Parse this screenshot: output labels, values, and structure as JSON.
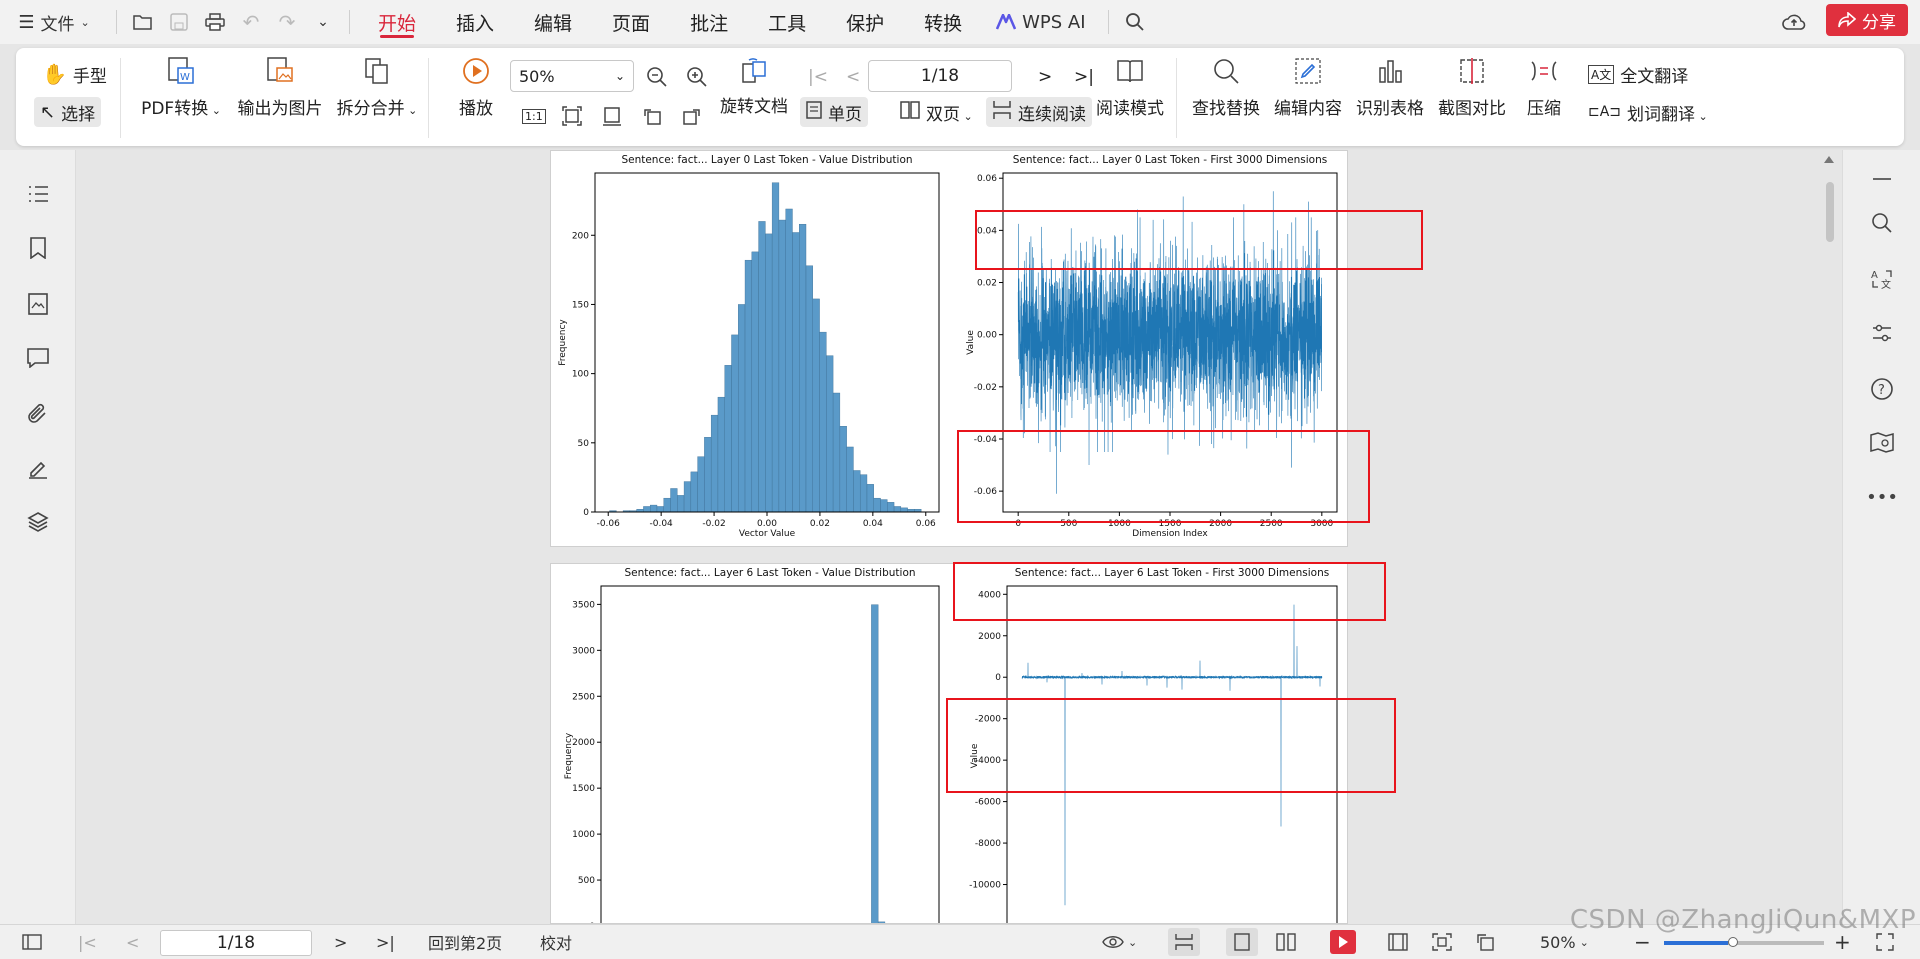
{
  "menubar": {
    "file_label": "文件",
    "tabs": [
      "开始",
      "插入",
      "编辑",
      "页面",
      "批注",
      "工具",
      "保护",
      "转换"
    ],
    "active_tab": "开始",
    "wps_ai_label": "WPS AI",
    "share_label": "分享",
    "accent_color": "#d9263b"
  },
  "ribbon": {
    "hand_label": "手型",
    "select_label": "选择",
    "pdf_convert_label": "PDF转换",
    "export_image_label": "输出为图片",
    "split_merge_label": "拆分合并",
    "play_label": "播放",
    "zoom_value": "50%",
    "page_value": "1/18",
    "rotate_label": "旋转文档",
    "single_page_label": "单页",
    "double_page_label": "双页",
    "continuous_label": "连续阅读",
    "reading_mode_label": "阅读模式",
    "find_replace_label": "查找替换",
    "edit_content_label": "编辑内容",
    "recognize_table_label": "识别表格",
    "screenshot_compare_label": "截图对比",
    "compress_label": "压缩",
    "full_translate_label": "全文翻译",
    "word_translate_label": "划词翻译"
  },
  "statusbar": {
    "page_value": "1/18",
    "back_label": "回到第2页",
    "proofread_label": "校对",
    "zoom_value": "50%"
  },
  "watermark": "CSDN @ZhangJiQun&MXP",
  "chart_data": [
    {
      "type": "bar",
      "title": "Sentence: fact... Layer 0 Last Token - Value Distribution",
      "xlabel": "Vector Value",
      "ylabel": "Frequency",
      "xlim": [
        -0.065,
        0.065
      ],
      "ylim": [
        0,
        245
      ],
      "xticks": [
        "-0.06",
        "-0.04",
        "-0.02",
        "0.00",
        "0.02",
        "0.04",
        "0.06"
      ],
      "xtick_values": [
        -0.06,
        -0.04,
        -0.02,
        0.0,
        0.02,
        0.04,
        0.06
      ],
      "yticks": [
        0,
        50,
        100,
        150,
        200
      ],
      "bin_start": -0.0595,
      "bin_width": 0.00256,
      "values": [
        1,
        0,
        1,
        1,
        2,
        4,
        5,
        4,
        10,
        17,
        12,
        22,
        29,
        40,
        54,
        70,
        83,
        106,
        128,
        150,
        182,
        188,
        210,
        201,
        238,
        211,
        219,
        202,
        208,
        178,
        154,
        130,
        113,
        86,
        62,
        47,
        30,
        27,
        20,
        10,
        9,
        7,
        4,
        3,
        2,
        2
      ],
      "bar_color": "#5a9ac9"
    },
    {
      "type": "line",
      "title": "Sentence: fact... Layer 0 Last Token - First 3000 Dimensions",
      "xlabel": "Dimension Index",
      "ylabel": "Value",
      "xlim": [
        -150,
        3150
      ],
      "ylim": [
        -0.068,
        0.062
      ],
      "xticks": [
        "0",
        "500",
        "1000",
        "1500",
        "2000",
        "2500",
        "3000"
      ],
      "xtick_values": [
        0,
        500,
        1000,
        1500,
        2000,
        2500,
        3000
      ],
      "yticks": [
        "-0.06",
        "-0.04",
        "-0.02",
        "0.00",
        "0.02",
        "0.04",
        "0.06"
      ],
      "ytick_values": [
        -0.06,
        -0.04,
        -0.02,
        0.0,
        0.02,
        0.04,
        0.06
      ],
      "n_points": 3000,
      "noise_sd": 0.015,
      "spikes": [
        [
          380,
          -0.061
        ],
        [
          700,
          -0.05
        ],
        [
          1180,
          0.048
        ],
        [
          1480,
          -0.046
        ],
        [
          1630,
          0.053
        ],
        [
          2230,
          0.05
        ],
        [
          2520,
          0.055
        ],
        [
          2700,
          -0.051
        ],
        [
          2870,
          0.051
        ]
      ],
      "line_color": "#1f77b4"
    },
    {
      "type": "bar",
      "title": "Sentence: fact... Layer 6 Last Token - Value Distribution",
      "xlabel": "",
      "ylabel": "Frequency",
      "xlim": [
        0,
        50
      ],
      "ylim": [
        0,
        3700
      ],
      "yticks": [
        0,
        500,
        1000,
        1500,
        2000,
        2500,
        3000,
        3500
      ],
      "values": [
        3,
        2,
        1,
        2,
        3,
        1,
        2,
        1,
        1,
        2,
        1,
        2,
        1,
        1,
        1,
        2,
        1,
        1,
        1,
        2,
        1,
        1,
        1,
        2,
        1,
        1,
        1,
        1,
        1,
        1,
        1,
        1,
        1,
        2,
        1,
        1,
        1,
        1,
        1,
        1,
        3497,
        45,
        3,
        2,
        1,
        1,
        1,
        2,
        1,
        1
      ],
      "bar_color": "#5a9ac9"
    },
    {
      "type": "line",
      "title": "Sentence: fact... Layer 6 Last Token - First 3000 Dimensions",
      "xlabel": "",
      "ylabel": "Value",
      "xlim": [
        -150,
        3150
      ],
      "ylim": [
        -12000,
        4400
      ],
      "yticks": [
        "-10000",
        "-8000",
        "-6000",
        "-4000",
        "-2000",
        "0",
        "2000",
        "4000"
      ],
      "ytick_values": [
        -10000,
        -8000,
        -6000,
        -4000,
        -2000,
        0,
        2000,
        4000
      ],
      "n_points": 3000,
      "spikes": [
        [
          60,
          700
        ],
        [
          250,
          -250
        ],
        [
          430,
          -11000
        ],
        [
          600,
          200
        ],
        [
          800,
          -350
        ],
        [
          1000,
          300
        ],
        [
          1250,
          -400
        ],
        [
          1450,
          -500
        ],
        [
          1600,
          -600
        ],
        [
          1780,
          800
        ],
        [
          2080,
          -650
        ],
        [
          2590,
          -7200
        ],
        [
          2720,
          3500
        ],
        [
          2750,
          1500
        ],
        [
          2980,
          -450
        ]
      ],
      "line_color": "#1f77b4"
    }
  ]
}
